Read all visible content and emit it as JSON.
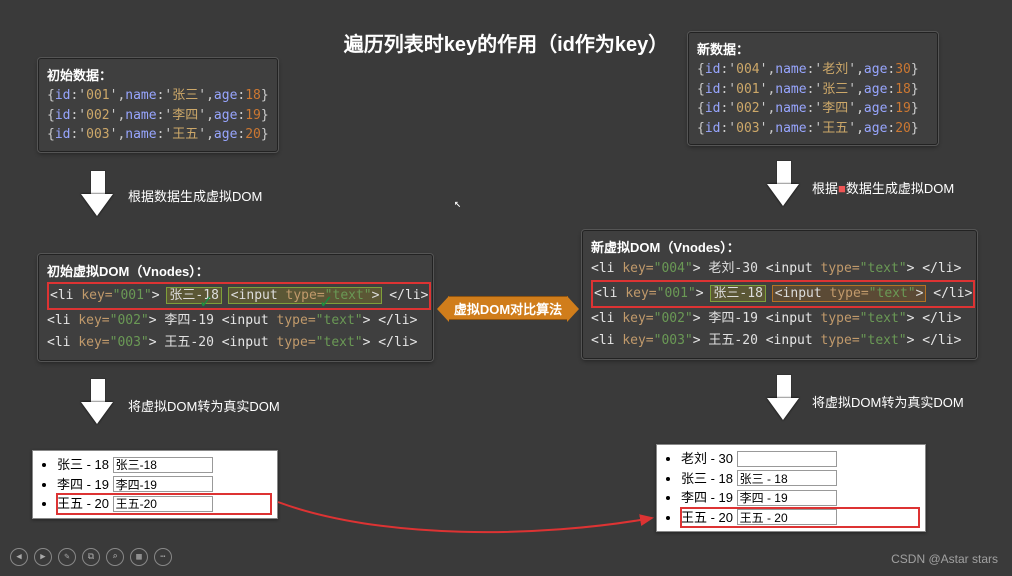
{
  "title": "遍历列表时key的作用（id作为key）",
  "left": {
    "data_hdr": "初始数据：",
    "rows": [
      {
        "id": "001",
        "name": "张三",
        "age": "18"
      },
      {
        "id": "002",
        "name": "李四",
        "age": "19"
      },
      {
        "id": "003",
        "name": "王五",
        "age": "20"
      }
    ],
    "arrow1": "根据数据生成虚拟DOM",
    "vnode_hdr": "初始虚拟DOM（Vnodes）：",
    "vnodes": [
      {
        "key": "001",
        "text": "张三-18",
        "hi": "green"
      },
      {
        "key": "002",
        "text": "李四-19"
      },
      {
        "key": "003",
        "text": "王五-20"
      }
    ],
    "arrow2": "将虚拟DOM转为真实DOM",
    "real": [
      {
        "label": "张三 - 18",
        "input": "张三-18"
      },
      {
        "label": "李四 - 19",
        "input": "李四-19"
      },
      {
        "label": "王五 - 20",
        "input": "王五-20",
        "red": true
      }
    ]
  },
  "right": {
    "data_hdr": "新数据：",
    "rows": [
      {
        "id": "004",
        "name": "老刘",
        "age": "30"
      },
      {
        "id": "001",
        "name": "张三",
        "age": "18"
      },
      {
        "id": "002",
        "name": "李四",
        "age": "19"
      },
      {
        "id": "003",
        "name": "王五",
        "age": "20"
      }
    ],
    "arrow1_a": "根据",
    "arrow1_b": "数据生成虚拟DOM",
    "vnode_hdr": "新虚拟DOM（Vnodes）：",
    "vnodes": [
      {
        "key": "004",
        "text": "老刘-30"
      },
      {
        "key": "001",
        "text": "张三-18",
        "hi": "split"
      },
      {
        "key": "002",
        "text": "李四-19"
      },
      {
        "key": "003",
        "text": "王五-20"
      }
    ],
    "arrow2": "将虚拟DOM转为真实DOM",
    "real": [
      {
        "label": "老刘 - 30",
        "input": ""
      },
      {
        "label": "张三 - 18",
        "input": "张三 - 18"
      },
      {
        "label": "李四 - 19",
        "input": "李四 - 19"
      },
      {
        "label": "王五 - 20",
        "input": "王五 - 20",
        "red": true
      }
    ]
  },
  "diff_label": "虚拟DOM对比算法",
  "watermark": "CSDN @Astar stars",
  "input_tag_full": "<input type=\"text\">",
  "input_tag_hi": "<input type=\"text\">"
}
